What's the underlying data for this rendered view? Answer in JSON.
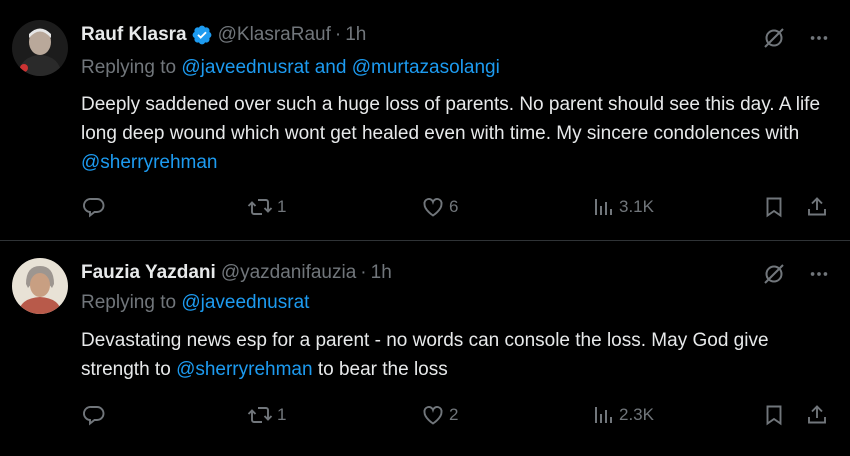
{
  "tweets": [
    {
      "name": "Rauf Klasra",
      "handle": "@KlasraRauf",
      "dot": "·",
      "time": "1h",
      "replying_prefix": "Replying to ",
      "replying_to_1": "@javeednusrat",
      "replying_and": " and ",
      "replying_to_2": "@murtazasolangi",
      "text": "Deeply saddened over such a huge loss of parents. No parent should see this day. A life long deep wound which wont get healed even with time. My sincere condolences with ",
      "mention": "@sherryrehman",
      "text_after": "",
      "retweets": "1",
      "likes": "6",
      "views": "3.1K"
    },
    {
      "name": "Fauzia Yazdani",
      "handle": "@yazdanifauzia",
      "dot": "·",
      "time": "1h",
      "replying_prefix": "Replying to ",
      "replying_to_1": "@javeednusrat",
      "text": "Devastating news esp for a parent - no words can console the loss. May God give strength to ",
      "mention": "@sherryrehman",
      "text_after": " to bear the loss",
      "retweets": "1",
      "likes": "2",
      "views": "2.3K"
    }
  ],
  "colors": {
    "background": "#000000",
    "text": "#e7e9ea",
    "muted": "#71767b",
    "link": "#1d9bf0",
    "divider": "#2f3336"
  },
  "icons": [
    "verified-badge-icon",
    "grok-icon",
    "more-icon",
    "reply-icon",
    "retweet-icon",
    "like-icon",
    "views-icon",
    "bookmark-icon",
    "share-icon"
  ]
}
